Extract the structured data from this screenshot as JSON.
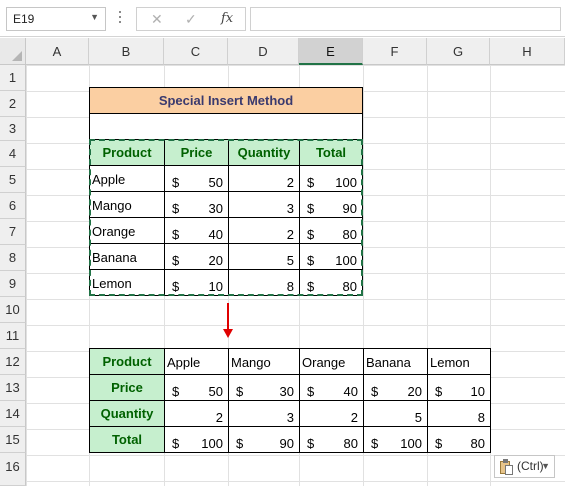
{
  "formula_bar": {
    "name_box": "E19",
    "name_box_dropdown": "▼",
    "cancel_glyph": "✕",
    "enter_glyph": "✓",
    "fx_label": "fx",
    "formula": ""
  },
  "columns": [
    "A",
    "B",
    "C",
    "D",
    "E",
    "F",
    "G",
    "H"
  ],
  "selected_column": "E",
  "rows": [
    "1",
    "2",
    "3",
    "4",
    "5",
    "6",
    "7",
    "8",
    "9",
    "10",
    "11",
    "12",
    "13",
    "14",
    "15",
    "16"
  ],
  "source_table": {
    "title": "Special Insert Method",
    "headers": [
      "Product",
      "Price",
      "Quantity",
      "Total"
    ],
    "rows": [
      {
        "product": "Apple",
        "price_currency": "$",
        "price": "50",
        "quantity": "2",
        "total_currency": "$",
        "total": "100"
      },
      {
        "product": "Mango",
        "price_currency": "$",
        "price": "30",
        "quantity": "3",
        "total_currency": "$",
        "total": "90"
      },
      {
        "product": "Orange",
        "price_currency": "$",
        "price": "40",
        "quantity": "2",
        "total_currency": "$",
        "total": "80"
      },
      {
        "product": "Banana",
        "price_currency": "$",
        "price": "20",
        "quantity": "5",
        "total_currency": "$",
        "total": "100"
      },
      {
        "product": "Lemon",
        "price_currency": "$",
        "price": "10",
        "quantity": "8",
        "total_currency": "$",
        "total": "80"
      }
    ]
  },
  "transposed_table": {
    "row_labels": [
      "Product",
      "Price",
      "Quantity",
      "Total"
    ],
    "products": [
      "Apple",
      "Mango",
      "Orange",
      "Banana",
      "Lemon"
    ],
    "currency": "$",
    "prices": [
      "50",
      "30",
      "40",
      "20",
      "10"
    ],
    "quantities": [
      "2",
      "3",
      "2",
      "5",
      "8"
    ],
    "totals": [
      "100",
      "90",
      "80",
      "100",
      "80"
    ]
  },
  "paste_options": {
    "label": "(Ctrl)",
    "caret": "▼"
  },
  "colors": {
    "title_fill": "#fbcfa2",
    "header_fill": "#c6efce",
    "header_text": "#006100",
    "marquee": "#217346",
    "arrow": "#e00000",
    "selected_header": "#217346"
  }
}
